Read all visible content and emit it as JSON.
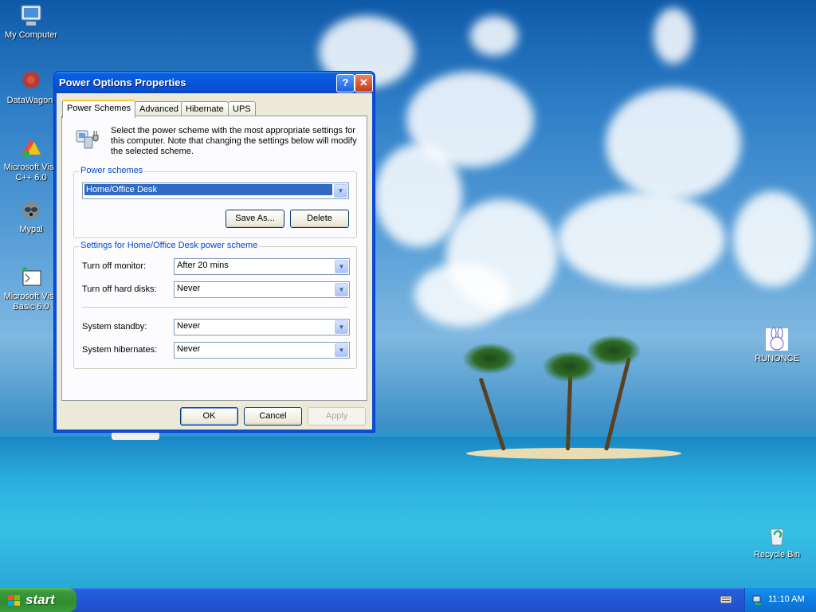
{
  "desktop": {
    "icons": [
      {
        "label": "My Computer"
      },
      {
        "label": "DataWagon."
      },
      {
        "label": "Microsoft Visu C++ 6.0"
      },
      {
        "label": "Mypal"
      },
      {
        "label": "Microsoft Visu Basic 6.0"
      },
      {
        "label": "RUNONCE"
      },
      {
        "label": "Recycle Bin"
      }
    ]
  },
  "window": {
    "title": "Power Options Properties",
    "help_glyph": "?",
    "close_glyph": "✕",
    "tabs": [
      {
        "label": "Power Schemes",
        "active": true
      },
      {
        "label": "Advanced",
        "active": false
      },
      {
        "label": "Hibernate",
        "active": false
      },
      {
        "label": "UPS",
        "active": false
      }
    ],
    "intro": "Select the power scheme with the most appropriate settings for this computer. Note that changing the settings below will modify the selected scheme.",
    "schemes_group": {
      "label": "Power schemes",
      "selected": "Home/Office Desk",
      "save_as": "Save As...",
      "delete": "Delete"
    },
    "settings_group": {
      "label": "Settings for Home/Office Desk power scheme",
      "rows": [
        {
          "label": "Turn off monitor:",
          "value": "After 20 mins"
        },
        {
          "label": "Turn off hard disks:",
          "value": "Never"
        },
        {
          "label": "System standby:",
          "value": "Never"
        },
        {
          "label": "System hibernates:",
          "value": "Never"
        }
      ]
    },
    "buttons": {
      "ok": "OK",
      "cancel": "Cancel",
      "apply": "Apply"
    }
  },
  "taskbar": {
    "start_label": "start",
    "clock": "11:10 AM"
  },
  "colors": {
    "titlebar": "#0855dd",
    "selection": "#316ac5",
    "group_label": "#0046d5",
    "start_green": "#3c9a3c"
  }
}
